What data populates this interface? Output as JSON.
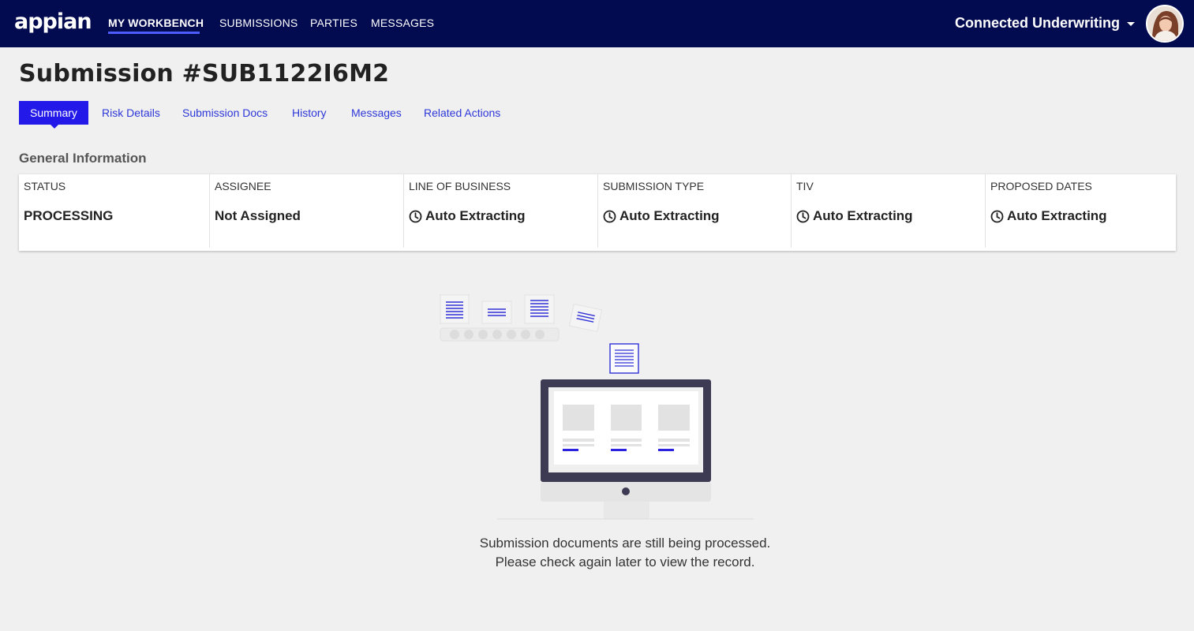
{
  "header": {
    "logo": "appian",
    "nav": [
      {
        "label": "MY WORKBENCH",
        "active": true
      },
      {
        "label": "SUBMISSIONS",
        "active": false
      },
      {
        "label": "PARTIES",
        "active": false
      },
      {
        "label": "MESSAGES",
        "active": false
      }
    ],
    "site_name": "Connected Underwriting",
    "avatar_icon": "user-avatar"
  },
  "page": {
    "title": "Submission #SUB1122I6M2",
    "tabs": [
      {
        "label": "Summary",
        "active": true
      },
      {
        "label": "Risk Details",
        "active": false
      },
      {
        "label": "Submission Docs",
        "active": false
      },
      {
        "label": "History",
        "active": false
      },
      {
        "label": "Messages",
        "active": false
      },
      {
        "label": "Related Actions",
        "active": false
      }
    ],
    "section_title": "General Information",
    "fields": [
      {
        "label": "STATUS",
        "value": "PROCESSING",
        "icon": ""
      },
      {
        "label": "ASSIGNEE",
        "value": "Not Assigned",
        "icon": ""
      },
      {
        "label": "LINE OF BUSINESS",
        "value": "Auto Extracting",
        "icon": "clock-icon"
      },
      {
        "label": "SUBMISSION TYPE",
        "value": "Auto Extracting",
        "icon": "clock-icon"
      },
      {
        "label": "TIV",
        "value": "Auto Extracting",
        "icon": "clock-icon"
      },
      {
        "label": "PROPOSED DATES",
        "value": "Auto Extracting",
        "icon": "clock-icon"
      }
    ],
    "message_line1": "Submission documents are still being processed.",
    "message_line2": "Please check again later to view the record."
  },
  "colors": {
    "header_bg": "#020a50",
    "accent": "#2319e8",
    "link": "#2e38d8",
    "page_bg": "#f0f0f0"
  }
}
